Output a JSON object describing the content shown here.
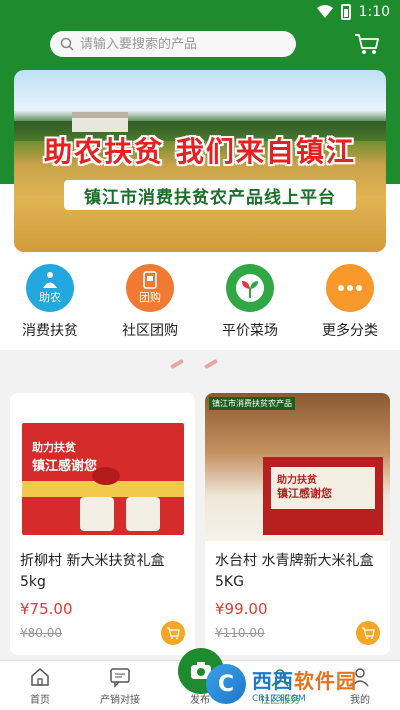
{
  "status_bar": {
    "time": "1:10"
  },
  "search": {
    "placeholder": "请输入要搜索的产品"
  },
  "banner": {
    "title": "助农扶贫 我们来自镇江",
    "subtitle": "镇江市消费扶贫农产品线上平台"
  },
  "categories": [
    {
      "label": "消费扶贫",
      "icon_text": "助农",
      "icon": "help-farmer-icon"
    },
    {
      "label": "社区团购",
      "icon_text": "团购",
      "icon": "group-buy-icon"
    },
    {
      "label": "平价菜场",
      "icon_text": "",
      "icon": "sprout-icon"
    },
    {
      "label": "更多分类",
      "icon_text": "",
      "icon": "more-icon"
    }
  ],
  "products": [
    {
      "name": "折柳村 新大米扶贫礼盒5kg",
      "price": "¥75.00",
      "old_price": "¥80.00",
      "box_line1": "助力扶贫",
      "box_line2": "镇江感谢您"
    },
    {
      "name": "水台村 水青牌新大米礼盒 5KG",
      "price": "¥99.00",
      "old_price": "¥110.00",
      "tag": "镇江市消费扶贫农产品",
      "box_line1": "助力扶贫",
      "box_line2": "镇江感谢您"
    }
  ],
  "bottom_nav": [
    {
      "label": "首页",
      "icon": "home-icon"
    },
    {
      "label": "产销对接",
      "icon": "message-icon"
    },
    {
      "label": "发布",
      "icon": "camera-icon"
    },
    {
      "label": "社区服务",
      "icon": "community-icon"
    },
    {
      "label": "我的",
      "icon": "user-icon"
    }
  ],
  "watermark": {
    "title_part1": "西西",
    "title_part2": "软件园",
    "url": "CR173.COM",
    "logo_text": "C"
  },
  "colors": {
    "primary": "#1e8b2f",
    "price": "#e53935",
    "cart_badge": "#f5a623"
  }
}
